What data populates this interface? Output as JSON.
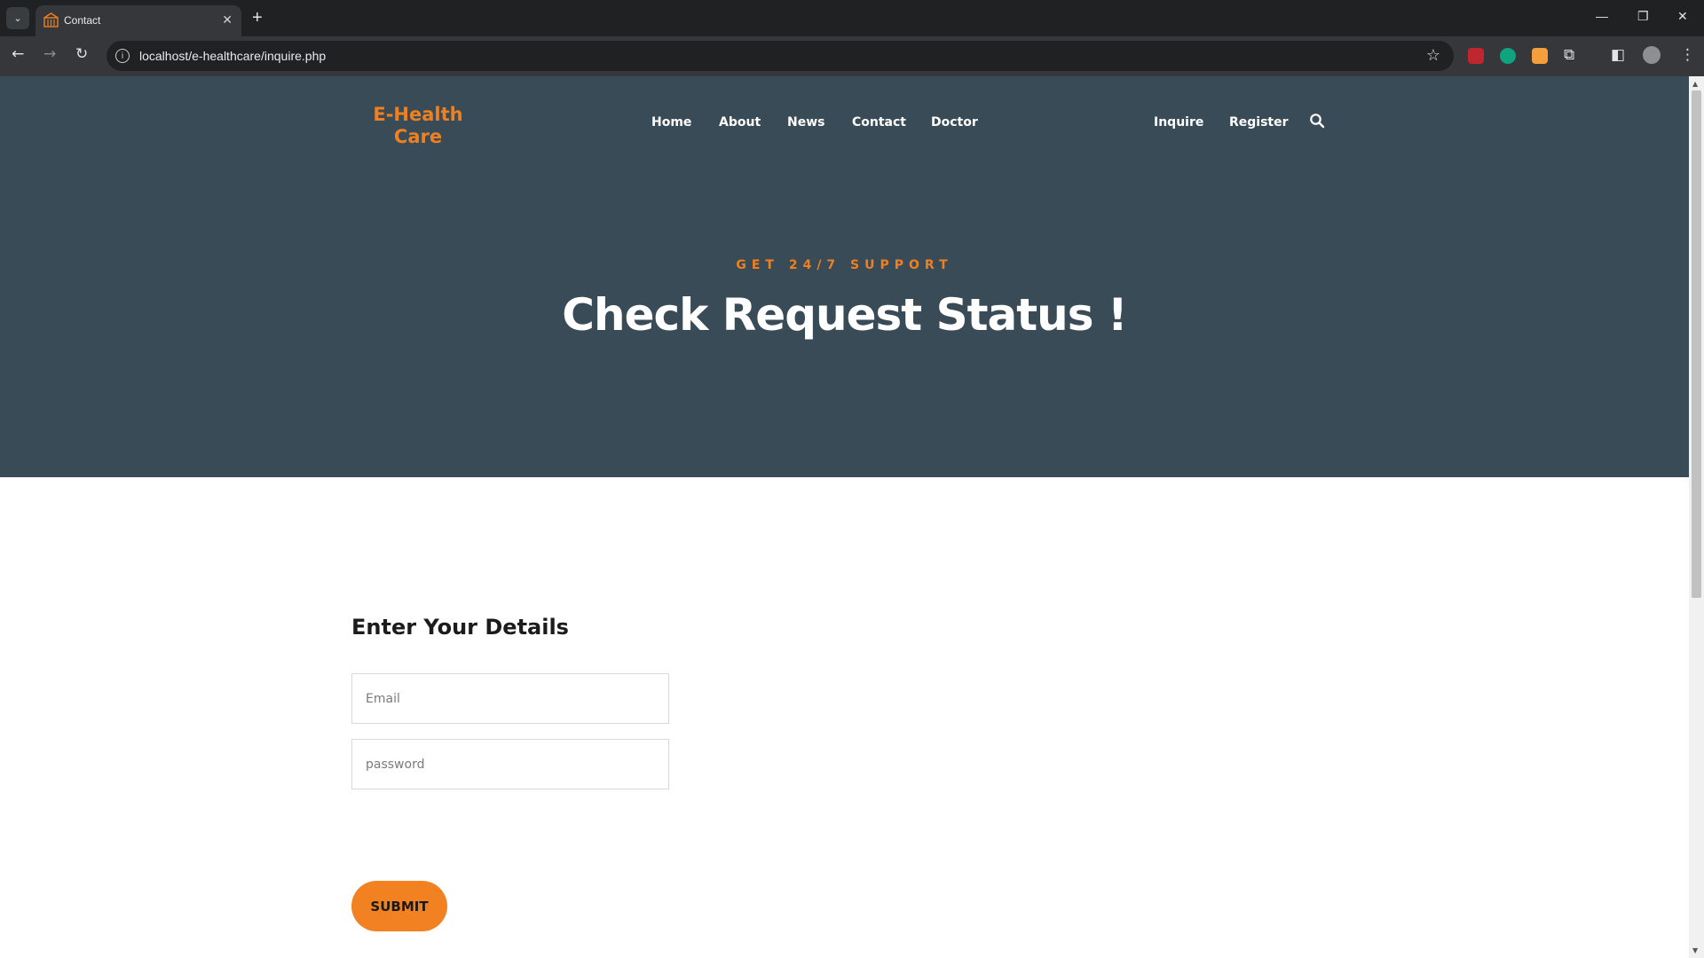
{
  "browser": {
    "tab_title": "Contact",
    "tab_close": "✕",
    "new_tab": "+",
    "url": "localhost/e-healthcare/inquire.php",
    "controls": {
      "minimize": "—",
      "restore": "❐",
      "close": "✕"
    },
    "icons": [
      "tab-search-icon",
      "back-icon",
      "forward-icon",
      "reload-icon",
      "info-icon",
      "star-icon",
      "extensions-icon",
      "side-panel-icon",
      "profile-icon",
      "menu-icon"
    ]
  },
  "site": {
    "logo": "E-Health Care",
    "nav": {
      "home": "Home",
      "about": "About",
      "news": "News",
      "contact": "Contact",
      "doctor": "Doctor",
      "inquire": "Inquire",
      "register": "Register"
    }
  },
  "hero": {
    "kicker": "GET 24/7 SUPPORT",
    "title": "Check Request Status !"
  },
  "form": {
    "title": "Enter Your Details",
    "email_placeholder": "Email",
    "password_placeholder": "password",
    "submit_label": "SUBMIT"
  },
  "colors": {
    "hero_bg": "#384b57",
    "accent": "#ef8020",
    "button": "#f28221"
  }
}
